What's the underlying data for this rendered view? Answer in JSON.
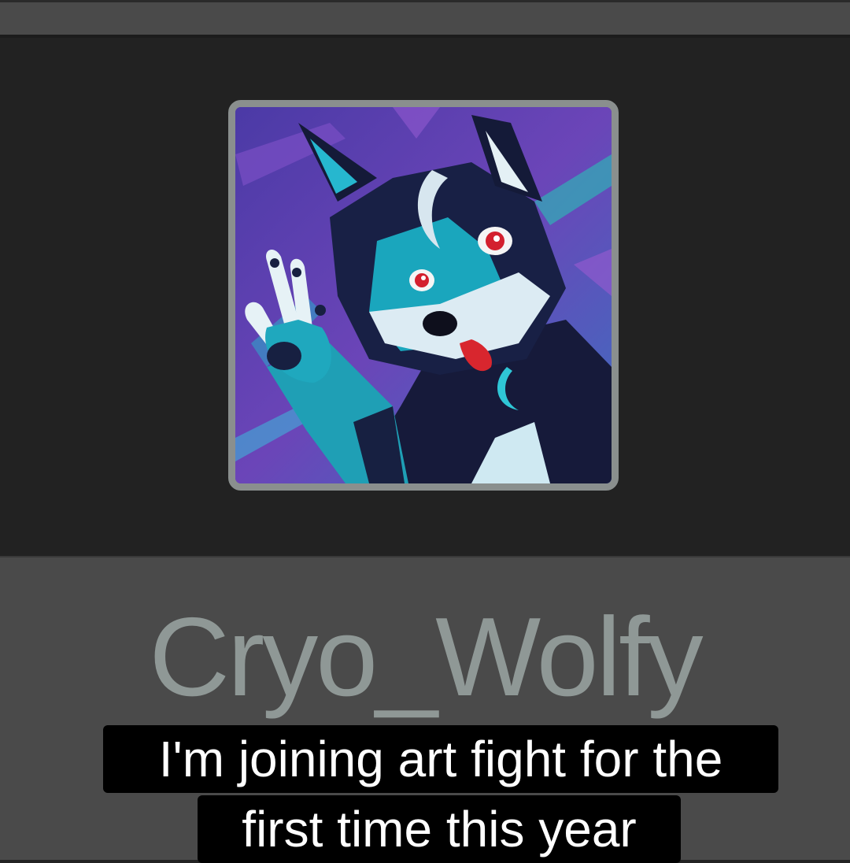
{
  "profile": {
    "username": "Cryo_Wolfy",
    "avatar_icon": "wolf-avatar"
  },
  "caption": {
    "line1": "I'm joining art fight for the",
    "line2": "first time this year"
  },
  "colors": {
    "page_bg": "#232323",
    "profile_bar_bg": "#4a4a4a",
    "username_text": "#8f9896",
    "avatar_border": "#8a8f8e",
    "caption_bg": "#000000",
    "caption_text": "#ffffff"
  }
}
